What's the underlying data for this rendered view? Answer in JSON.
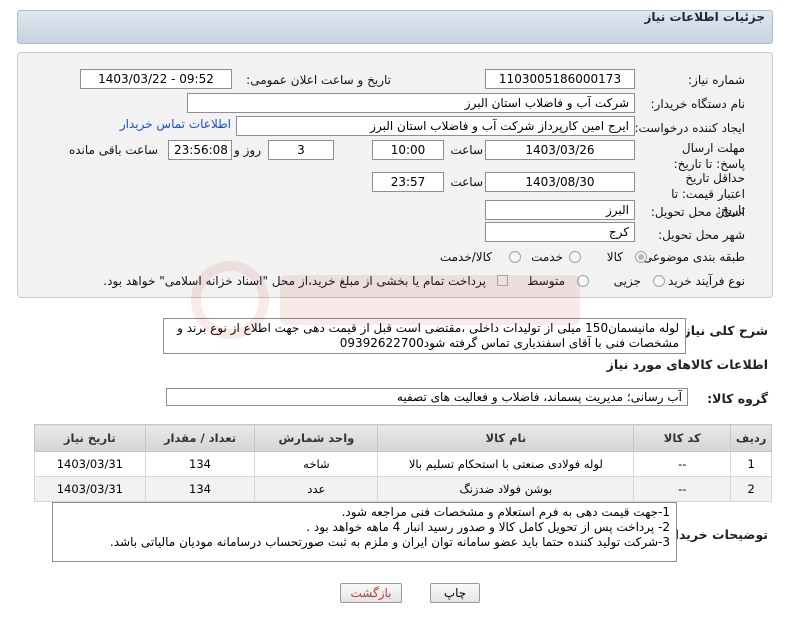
{
  "header": {
    "title": "جزئیات اطلاعات نیاز"
  },
  "labels": {
    "need_number": "شماره نیاز:",
    "announce_datetime": "تاریخ و ساعت اعلان عمومی:",
    "buyer_org": "نام دستگاه خریدار:",
    "requester": "ایجاد کننده درخواست:",
    "reply_deadline": "مهلت ارسال پاسخ: تا تاریخ:",
    "hour": "ساعت",
    "day_and": "روز و",
    "remaining_hours": "ساعت باقی مانده",
    "price_validity": "حداقل تاریخ اعتبار قیمت: تا تاریخ:",
    "province": "استان محل تحویل:",
    "city": "شهر محل تحویل:",
    "category": "طبقه بندی موضوعی:",
    "purchase_type": "نوع فرآیند خرید :",
    "description": "شرح کلی نیاز:",
    "goods_info": "اطلاعات کالاهای مورد نیاز",
    "goods_group": "گروه کالا:",
    "buyer_notes": "توضیحات خریدار:"
  },
  "fields": {
    "need_number": "1103005186000173",
    "announce_datetime": "1403/03/22 - 09:52",
    "buyer_org": "شرکت آب و فاضلاب استان البرز",
    "requester": "ایرج امین کارپرداز شرکت آب و فاضلاب استان البرز",
    "contact_link": "اطلاعات تماس خریدار",
    "reply_date": "1403/03/26",
    "reply_time": "10:00",
    "days_remaining": "3",
    "time_remaining": "23:56:08",
    "validity_date": "1403/08/30",
    "validity_time": "23:57",
    "province": "البرز",
    "city": "کرج"
  },
  "category_options": [
    {
      "label": "کالا",
      "selected": true
    },
    {
      "label": "خدمت",
      "selected": false
    },
    {
      "label": "کالا/خدمت",
      "selected": false
    }
  ],
  "purchase_options": [
    {
      "label": "جزیی",
      "selected": false
    },
    {
      "label": "متوسط",
      "selected": false
    }
  ],
  "payment_note": "پرداخت تمام یا بخشی از مبلغ خرید،از محل \"اسناد خزانه اسلامی\" خواهد بود.",
  "description": "لوله مانیسمان150 میلی از تولیدات داخلی ،مقتضی است قبل از قیمت دهی جهت اطلاع از نوع برند و مشخصات فنی با آقای اسفندیاری تماس گرفته شود09392622700",
  "goods_group": "آب رسانی؛ مدیریت پسماند، فاضلاب و فعالیت های تصفیه",
  "table": {
    "headers": [
      "ردیف",
      "کد کالا",
      "نام کالا",
      "واحد شمارش",
      "تعداد / مقدار",
      "تاریخ نیاز"
    ],
    "rows": [
      [
        "1",
        "--",
        "لوله فولادی صنعتی با استحکام تسلیم بالا",
        "شاخه",
        "134",
        "1403/03/31"
      ],
      [
        "2",
        "--",
        "بوشن فولاد ضدزنگ",
        "عدد",
        "134",
        "1403/03/31"
      ]
    ]
  },
  "notes": [
    "1-جهت قیمت دهی به فرم استعلام و مشخصات فنی مراجعه شود.",
    "2- پرداخت پس از تحویل کامل کالا و صدور رسید انبار 4 ماهه خواهد بود .",
    "3-شرکت تولید کننده حتما باید عضو سامانه توان ایران و ملزم به ثبت صورتحساب درسامانه مودیان مالیاتی باشد."
  ],
  "buttons": {
    "print": "چاپ",
    "back": "بازگشت"
  },
  "colors": {
    "link": "#1a4ec9",
    "back_button_text": "#c0392b"
  }
}
